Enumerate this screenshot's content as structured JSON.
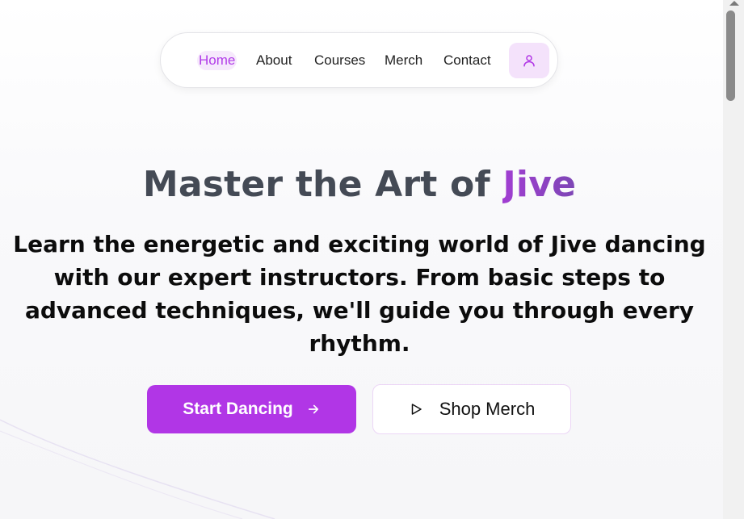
{
  "nav": {
    "items": [
      {
        "label": "Home",
        "active": true
      },
      {
        "label": "About"
      },
      {
        "label": "Courses"
      },
      {
        "label": "Merch"
      },
      {
        "label": "Contact"
      }
    ],
    "user_icon": "user-icon"
  },
  "hero": {
    "title_prefix": "Master the Art of ",
    "title_accent": "Jive",
    "subtitle": "Learn the energetic and exciting world of Jive dancing with our expert instructors. From basic steps to advanced techniques, we'll guide you through every rhythm."
  },
  "buttons": {
    "primary_label": "Start Dancing",
    "primary_icon": "arrow-right-icon",
    "secondary_label": "Shop Merch",
    "secondary_icon": "play-icon"
  },
  "colors": {
    "accent": "#b136e6",
    "accent_light": "#f4e2fb",
    "title_gray": "#444a55"
  }
}
